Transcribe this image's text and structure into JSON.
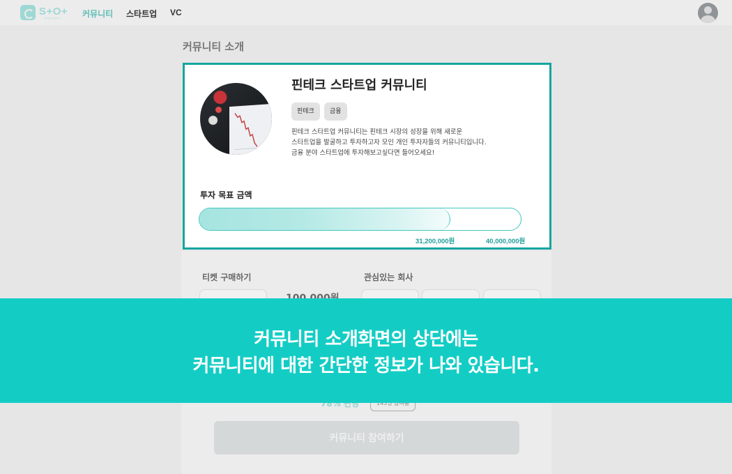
{
  "header": {
    "logo_text": "S+O+",
    "logo_sub": "Startup Owners",
    "nav": [
      "커뮤니티",
      "스타트업",
      "VC"
    ],
    "active_color": "#5fbcb6"
  },
  "page": {
    "section_title": "커뮤니티 소개"
  },
  "card": {
    "title": "핀테크 스타트업 커뮤니티",
    "tags": [
      "핀테크",
      "금융"
    ],
    "description_lines": [
      "핀테크 스타트업 커뮤니티는 핀테크 시장의 성장을 위해 새로운",
      "스타트업을 발굴하고 투자하고자 모인 개인 투자자들의 커뮤니티입니다.",
      "금융 분야 스타트업에 투자해보고싶다면 들어오세요!"
    ],
    "goal_label": "투자 목표 금액",
    "current_amount": "31,200,000원",
    "target_amount": "40,000,000원",
    "progress_fraction": 0.78,
    "accent_color": "#16a5a0",
    "thumbnail_icon": "stock-chart-image"
  },
  "lower": {
    "ticket_title": "티켓 구매하기",
    "price": "100,000원",
    "interest_title": "관심있는 회사",
    "funding_status": "78% 펀딩",
    "participants": "145명 참여중",
    "join_button": "커뮤니티 참여하기"
  },
  "banner": {
    "line1": "커뮤니티 소개화면의 상단에는",
    "line2": "커뮤니티에 대한 간단한 정보가 나와 있습니다.",
    "color": "#13cdc5"
  }
}
